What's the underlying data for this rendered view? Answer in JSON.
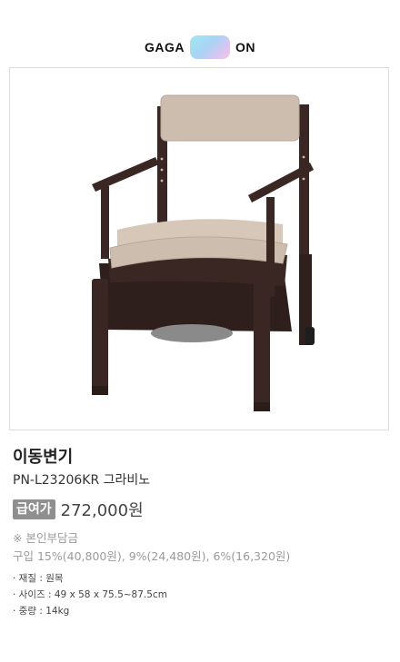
{
  "logo": {
    "left_text": "GAGA",
    "right_text": "ON"
  },
  "product": {
    "title": "이동변기",
    "model": "PN-L23206KR 그라비노",
    "badge": "급여가",
    "price": "272,000원",
    "note": "※ 본인부담금",
    "purchase": "구입 15%(40,800원), 9%(24,480원), 6%(16,320원)",
    "specs": [
      "· 재질 : 원목",
      "· 사이즈 : 49 x 58 x 75.5~87.5cm",
      "· 중량 : 14kg"
    ],
    "image_alt": "portable-commode-chair"
  },
  "colors": {
    "wood": "#3a2723",
    "cushion": "#cdbdae",
    "badge": "#8f8f8f"
  }
}
